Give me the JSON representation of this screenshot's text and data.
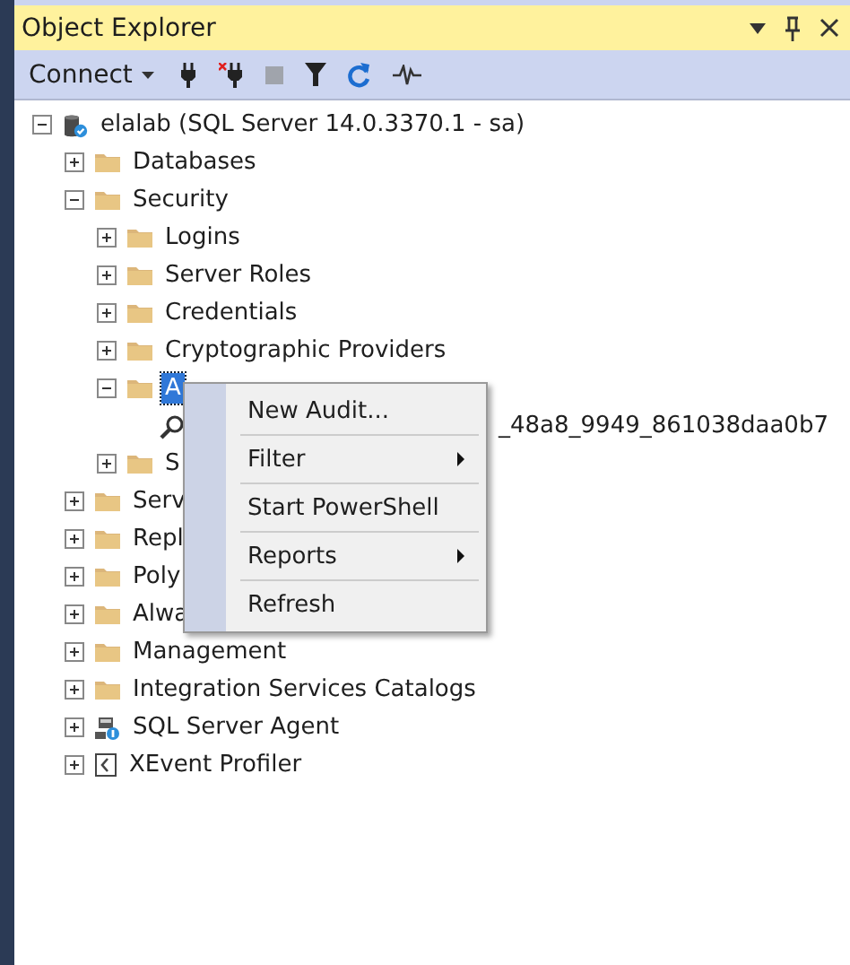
{
  "panel": {
    "title": "Object Explorer"
  },
  "toolbar": {
    "connect": "Connect"
  },
  "tree": [
    {
      "label": "elalab (SQL Server 14.0.3370.1 - sa)",
      "kind": "server",
      "expanded": true,
      "selected": false,
      "children": [
        {
          "label": "Databases",
          "kind": "folder",
          "expanded": false,
          "selected": false
        },
        {
          "label": "Security",
          "kind": "folder",
          "expanded": true,
          "selected": false,
          "children": [
            {
              "label": "Logins",
              "kind": "folder",
              "expanded": false,
              "selected": false
            },
            {
              "label": "Server Roles",
              "kind": "folder",
              "expanded": false,
              "selected": false
            },
            {
              "label": "Credentials",
              "kind": "folder",
              "expanded": false,
              "selected": false
            },
            {
              "label": "Cryptographic Providers",
              "kind": "folder",
              "expanded": false,
              "selected": false
            },
            {
              "label": "A",
              "kind": "folder",
              "expanded": true,
              "selected": true,
              "children": [
                {
                  "label": "_48a8_9949_861038daa0b7",
                  "kind": "audit",
                  "selected": false
                }
              ]
            },
            {
              "label": "S",
              "kind": "folder",
              "expanded": false,
              "selected": false
            }
          ]
        },
        {
          "label": "Serv",
          "kind": "folder",
          "expanded": false,
          "selected": false
        },
        {
          "label": "Repl",
          "kind": "folder",
          "expanded": false,
          "selected": false
        },
        {
          "label": "Poly",
          "kind": "folder",
          "expanded": false,
          "selected": false
        },
        {
          "label": "Alwa",
          "kind": "folder",
          "expanded": false,
          "selected": false
        },
        {
          "label": "Management",
          "kind": "folder",
          "expanded": false,
          "selected": false
        },
        {
          "label": "Integration Services Catalogs",
          "kind": "folder",
          "expanded": false,
          "selected": false
        },
        {
          "label": "SQL Server Agent",
          "kind": "agent",
          "expanded": false,
          "selected": false
        },
        {
          "label": "XEvent Profiler",
          "kind": "xevent",
          "expanded": false,
          "selected": false
        }
      ]
    }
  ],
  "context_menu": {
    "items": [
      {
        "label": "New Audit...",
        "submenu": false
      },
      {
        "label": "Filter",
        "submenu": true
      },
      {
        "label": "Start PowerShell",
        "submenu": false
      },
      {
        "label": "Reports",
        "submenu": true
      },
      {
        "label": "Refresh",
        "submenu": false
      }
    ]
  }
}
